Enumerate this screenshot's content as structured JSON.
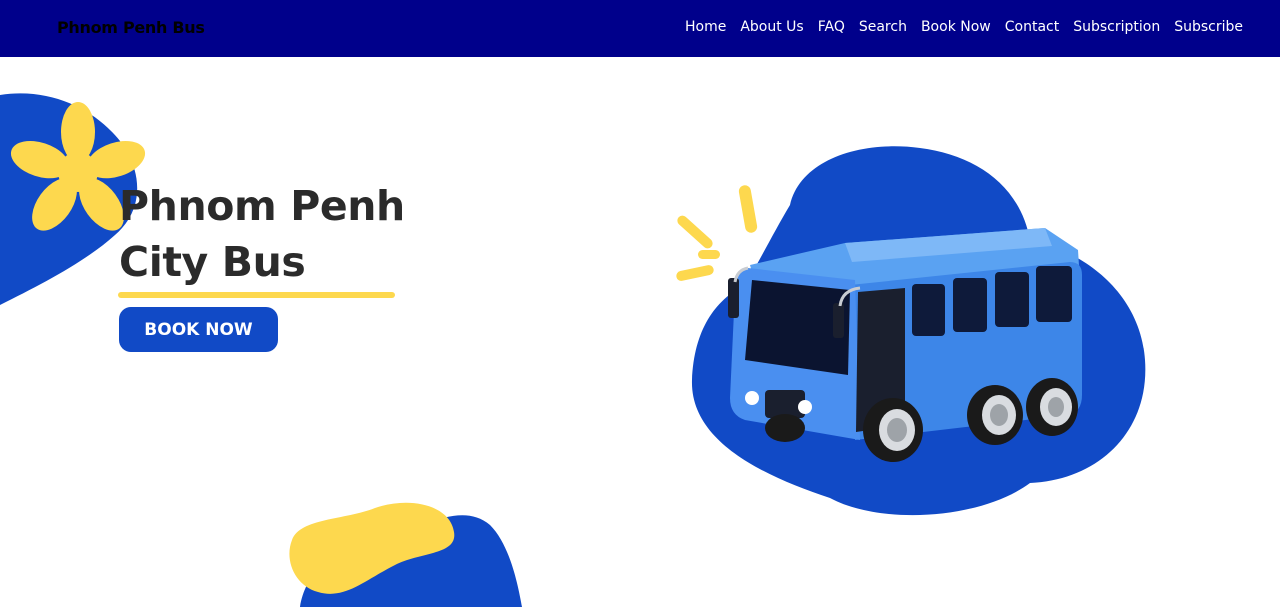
{
  "header": {
    "brand": "Phnom Penh Bus",
    "nav": [
      "Home",
      "About Us",
      "FAQ",
      "Search",
      "Book Now",
      "Contact",
      "Subscription",
      "Subscribe"
    ]
  },
  "hero": {
    "title_line1": "Phnom Penh",
    "title_line2": "City Bus",
    "cta_label": "BOOK NOW"
  },
  "colors": {
    "navbar": "#00008b",
    "accent_blue": "#114ac6",
    "accent_yellow": "#fdd84e",
    "bus_body": "#3d86e8",
    "text_dark": "#2b2b2b"
  },
  "icons": {
    "flower": "yellow-flower-icon",
    "bus": "bus-illustration"
  }
}
